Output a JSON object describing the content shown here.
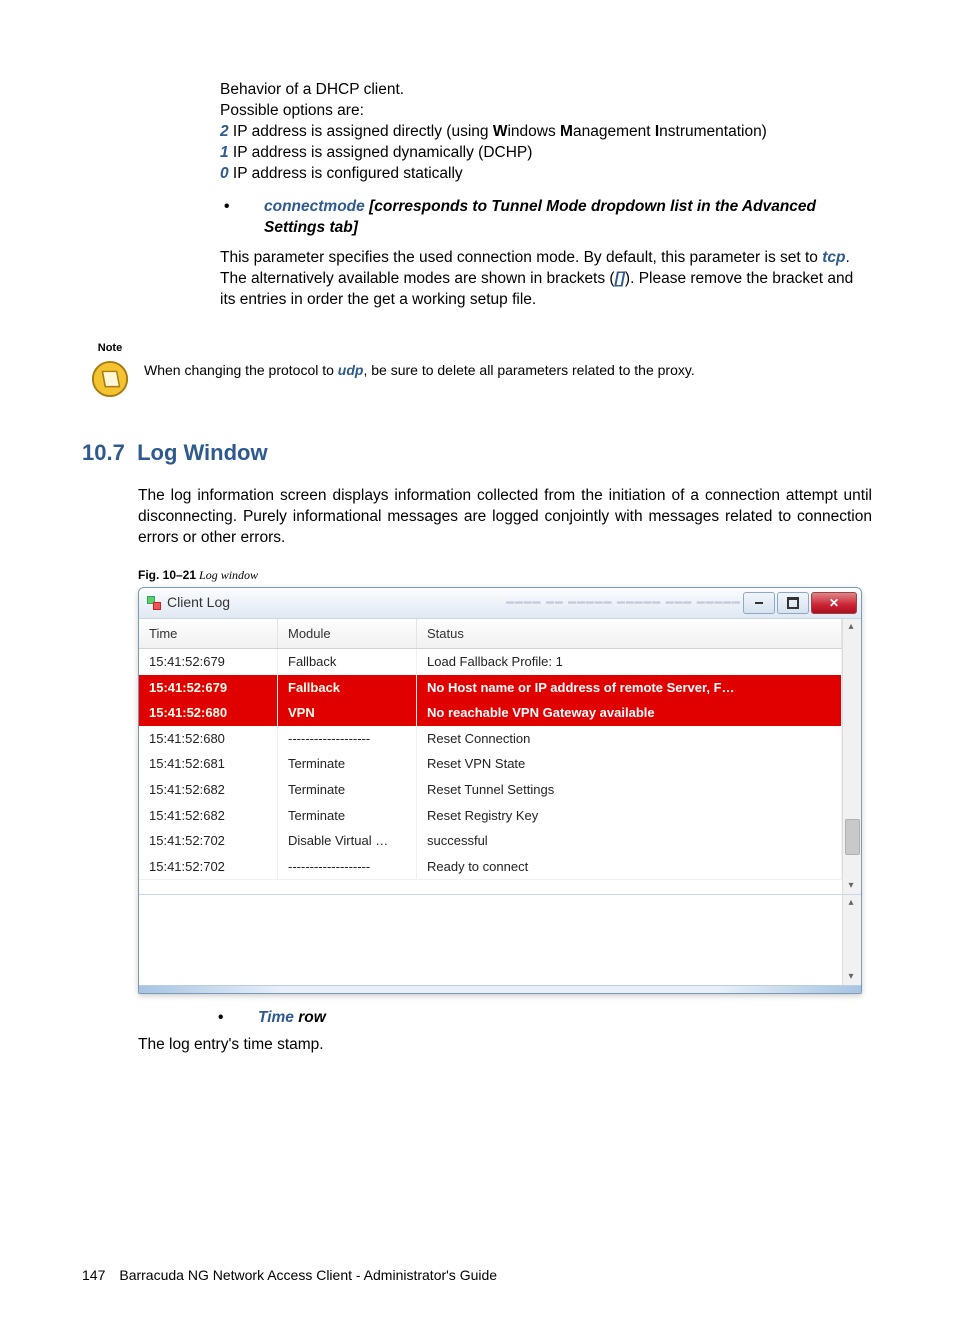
{
  "top": {
    "line1": "Behavior of a DHCP client.",
    "line2": "Possible options are:",
    "opt2_num": "2",
    "opt2_txt": " IP address is assigned directly (using ",
    "opt2_w": "W",
    "opt2_windows": "indows ",
    "opt2_m": "M",
    "opt2_anagement": "anagement ",
    "opt2_i": "I",
    "opt2_nstr": "nstrumentation)",
    "opt1_num": "1",
    "opt1_txt": " IP address is assigned dynamically (DCHP)",
    "opt0_num": "0",
    "opt0_txt": " IP address is configured statically",
    "bullet_param": "connectmode",
    "bullet_rest": " [corresponds to Tunnel Mode dropdown list in the Advanced Settings tab]",
    "para_a": "This parameter specifies the used connection mode. By default, this parameter is set to ",
    "para_tcp": "tcp",
    "para_b": ". The alternatively available modes are shown in brackets (",
    "para_bracket": "[]",
    "para_c": "). Please remove the bracket and its entries in order the get a working setup file."
  },
  "note": {
    "label": "Note",
    "text_a": "When changing the protocol to ",
    "udp": "udp",
    "text_b": ", be sure to delete all parameters related to the proxy."
  },
  "section": {
    "num": "10.7",
    "title": "Log Window",
    "para": "The log information screen displays information collected from the initiation of a connection attempt until disconnecting. Purely informational messages are logged conjointly with messages related to connection errors or other errors.",
    "fig_num": "Fig. 10–21",
    "fig_txt": " Log window"
  },
  "window": {
    "title": "Client Log",
    "columns": {
      "time": "Time",
      "module": "Module",
      "status": "Status"
    },
    "rows": [
      {
        "time": "15:41:52:679",
        "module": "Fallback",
        "status": "Load Fallback Profile: 1",
        "err": false
      },
      {
        "time": "15:41:52:679",
        "module": "Fallback",
        "status": "No Host name or IP address of remote Server,  F…",
        "err": true
      },
      {
        "time": "15:41:52:680",
        "module": "VPN",
        "status": "No reachable VPN Gateway available",
        "err": true
      },
      {
        "time": "15:41:52:680",
        "module": "-------------------",
        "status": "Reset Connection",
        "err": false
      },
      {
        "time": "15:41:52:681",
        "module": "Terminate",
        "status": "Reset VPN State",
        "err": false
      },
      {
        "time": "15:41:52:682",
        "module": "Terminate",
        "status": "Reset Tunnel Settings",
        "err": false
      },
      {
        "time": "15:41:52:682",
        "module": "Terminate",
        "status": "Reset Registry Key",
        "err": false
      },
      {
        "time": "15:41:52:702",
        "module": "Disable Virtual …",
        "status": "successful",
        "err": false
      },
      {
        "time": "15:41:52:702",
        "module": "-------------------",
        "status": "Ready to connect",
        "err": false
      }
    ]
  },
  "below": {
    "bullet_param": "Time",
    "bullet_rest": " row",
    "desc": "The log entry's time stamp."
  },
  "footer": {
    "page": "147",
    "book": "Barracuda NG Network Access Client - Administrator's Guide"
  }
}
